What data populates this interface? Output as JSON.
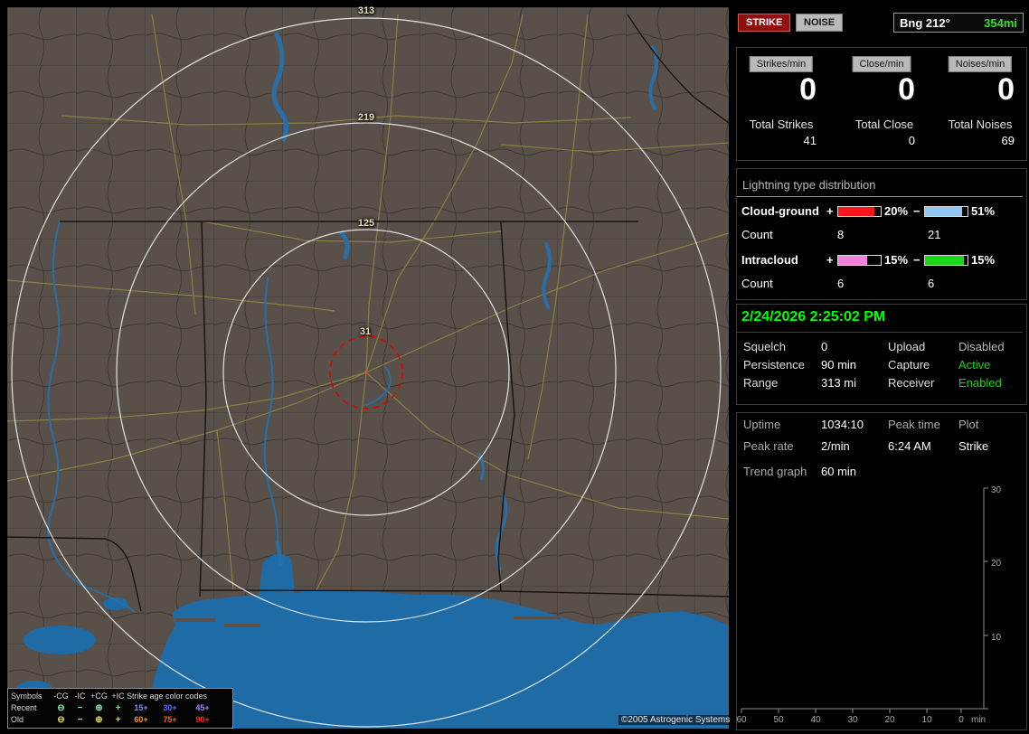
{
  "colors": {
    "accent_green": "#00ff00",
    "distance_green": "#35e02a",
    "strike_button_red": "#8f0f0f",
    "map_land": "#59504a",
    "map_water": "#1f6ba6",
    "ring_white": "#f2f2f2",
    "alarm_ring_red": "#e00000"
  },
  "map": {
    "ring_labels": [
      "313",
      "219",
      "125",
      "31"
    ],
    "credit": "©2005 Astrogenic Systems",
    "legend": {
      "header_symbols": "Symbols",
      "columns": [
        "-CG",
        "-IC",
        "+CG",
        "+IC"
      ],
      "header_age": "Strike age color codes",
      "rows": [
        {
          "label": "Recent",
          "symbol_color": "#7fe0a0",
          "symbols": [
            "⊖",
            "−",
            "⊕",
            "+"
          ],
          "ages": [
            {
              "text": "15+",
              "color": "#7c8cff"
            },
            {
              "text": "30+",
              "color": "#5a6cff"
            },
            {
              "text": "45+",
              "color": "#a97fff"
            }
          ]
        },
        {
          "label": "Old",
          "symbol_color": "#e2da58",
          "symbols": [
            "⊖",
            "−",
            "⊕",
            "+"
          ],
          "ages": [
            {
              "text": "60+",
              "color": "#ff9526"
            },
            {
              "text": "75+",
              "color": "#ff5c1e"
            },
            {
              "text": "90+",
              "color": "#ff2222"
            }
          ]
        }
      ]
    }
  },
  "panel": {
    "modes": [
      {
        "label": "STRIKE"
      },
      {
        "label": "NOISE"
      }
    ],
    "bearing": {
      "text": "Bng 212°",
      "distance": "354mi"
    },
    "rates": [
      {
        "chip": "Strikes/min",
        "value": "0",
        "total_label": "Total Strikes",
        "total_value": "41"
      },
      {
        "chip": "Close/min",
        "value": "0",
        "total_label": "Total Close",
        "total_value": "0"
      },
      {
        "chip": "Noises/min",
        "value": "0",
        "total_label": "Total Noises",
        "total_value": "69"
      }
    ],
    "distribution": {
      "title": "Lightning type distribution",
      "rows": [
        {
          "label": "Cloud-ground",
          "pos_sign": "+",
          "pos_fill": 86,
          "pos_color": "#ff1515",
          "pos_pct": "20%",
          "neg_sign": "−",
          "neg_fill": 88,
          "neg_color": "#8fc6f2",
          "neg_pct": "51%",
          "count_label": "Count",
          "pos_count": "8",
          "neg_count": "21"
        },
        {
          "label": "Intracloud",
          "pos_sign": "+",
          "pos_fill": 68,
          "pos_color": "#f27fdc",
          "pos_pct": "15%",
          "neg_sign": "−",
          "neg_fill": 92,
          "neg_color": "#18d818",
          "neg_pct": "15%",
          "count_label": "Count",
          "pos_count": "6",
          "neg_count": "6"
        }
      ]
    },
    "status": {
      "datetime": "2/24/2026 2:25:02 PM",
      "rows": [
        {
          "label1": "Squelch",
          "value1": "0",
          "label2": "Upload",
          "value2": "Disabled",
          "value2_color": "#b8b8b8"
        },
        {
          "label1": "Persistence",
          "value1": "90 min",
          "label2": "Capture",
          "value2": "Active",
          "value2_color": "#15d415"
        },
        {
          "label1": "Range",
          "value1": "313 mi",
          "label2": "Receiver",
          "value2": "Enabled",
          "value2_color": "#15d415"
        }
      ]
    },
    "session": {
      "row1": [
        "Uptime",
        "1034:10",
        "Peak time",
        "Plot"
      ],
      "row2": [
        "Peak rate",
        "2/min",
        "6:24 AM",
        "Strike"
      ],
      "trend_label": "Trend graph",
      "trend_value": "60 min"
    },
    "trend_chart": {
      "type": "line",
      "y_ticks": [
        "30",
        "20",
        "10"
      ],
      "x_ticks": [
        "60",
        "50",
        "40",
        "30",
        "20",
        "10",
        "0"
      ],
      "unit": "min",
      "y_range": [
        0,
        30
      ],
      "x_range_minutes": [
        60,
        0
      ],
      "series": []
    }
  }
}
